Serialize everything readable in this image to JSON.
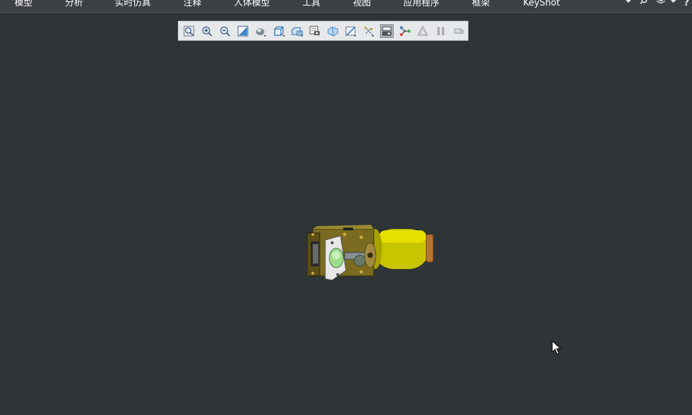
{
  "menubar": {
    "items": [
      {
        "label": "模型"
      },
      {
        "label": "分析"
      },
      {
        "label": "实时仿真"
      },
      {
        "label": "注释"
      },
      {
        "label": "人体模型"
      },
      {
        "label": "工具"
      },
      {
        "label": "视图"
      },
      {
        "label": "应用程序"
      },
      {
        "label": "框架"
      },
      {
        "label": "KeyShot"
      }
    ],
    "right_icons": [
      "dropdown-icon",
      "search-icon",
      "layers-icon",
      "dropdown-icon",
      "help-icon"
    ],
    "help_label": "?"
  },
  "view_toolbar": {
    "buttons": [
      {
        "icon": "refit-icon",
        "active": false
      },
      {
        "icon": "zoom-in-icon",
        "active": false
      },
      {
        "icon": "zoom-out-icon",
        "active": false
      },
      {
        "icon": "zoom-window-icon",
        "active": false
      },
      {
        "icon": "display-style-icon",
        "active": false
      },
      {
        "icon": "saved-orientations-icon",
        "active": false
      },
      {
        "icon": "view-manager-icon",
        "active": false
      },
      {
        "icon": "perspective-view-icon",
        "active": false
      },
      {
        "icon": "section-icon",
        "active": false
      },
      {
        "icon": "annotation-display-icon",
        "active": false
      },
      {
        "icon": "datum-display-icon",
        "active": false
      },
      {
        "icon": "spin-center-icon",
        "active": true
      },
      {
        "icon": "connect-icon",
        "active": false
      },
      {
        "icon": "simulation-icon",
        "active": false
      },
      {
        "icon": "pause-icon",
        "active": false
      },
      {
        "icon": "stop-icon",
        "active": false
      }
    ]
  },
  "colors": {
    "background": "#2f3436",
    "menubar": "#3c4145",
    "toolbar": "#e6e8ea",
    "model_yellow": "#d8d000",
    "model_copper": "#b87333"
  }
}
